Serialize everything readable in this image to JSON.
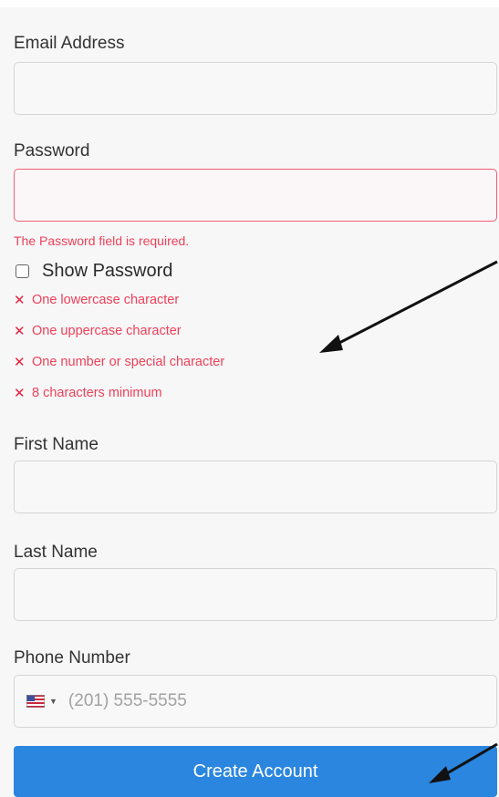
{
  "form": {
    "email": {
      "label": "Email Address",
      "value": ""
    },
    "password": {
      "label": "Password",
      "value": "",
      "error": "The Password field is required."
    },
    "show_password": {
      "label": "Show Password",
      "checked": false
    },
    "password_rules": [
      {
        "icon": "x-icon",
        "symbol": "✕",
        "text": "One lowercase character",
        "status": "unmet"
      },
      {
        "icon": "x-icon",
        "symbol": "✕",
        "text": "One uppercase character",
        "status": "unmet"
      },
      {
        "icon": "x-icon",
        "symbol": "✕",
        "text": "One number or special character",
        "status": "unmet"
      },
      {
        "icon": "x-icon",
        "symbol": "✕",
        "text": "8 characters minimum",
        "status": "unmet"
      }
    ],
    "first_name": {
      "label": "First Name",
      "value": ""
    },
    "last_name": {
      "label": "Last Name",
      "value": ""
    },
    "phone": {
      "label": "Phone Number",
      "country_icon": "us-flag-icon",
      "placeholder": "(201) 555-5555"
    },
    "submit_label": "Create Account"
  },
  "colors": {
    "error": "#ee4158",
    "primary_button": "#2a86de",
    "annotation_arrow": "#111111"
  }
}
